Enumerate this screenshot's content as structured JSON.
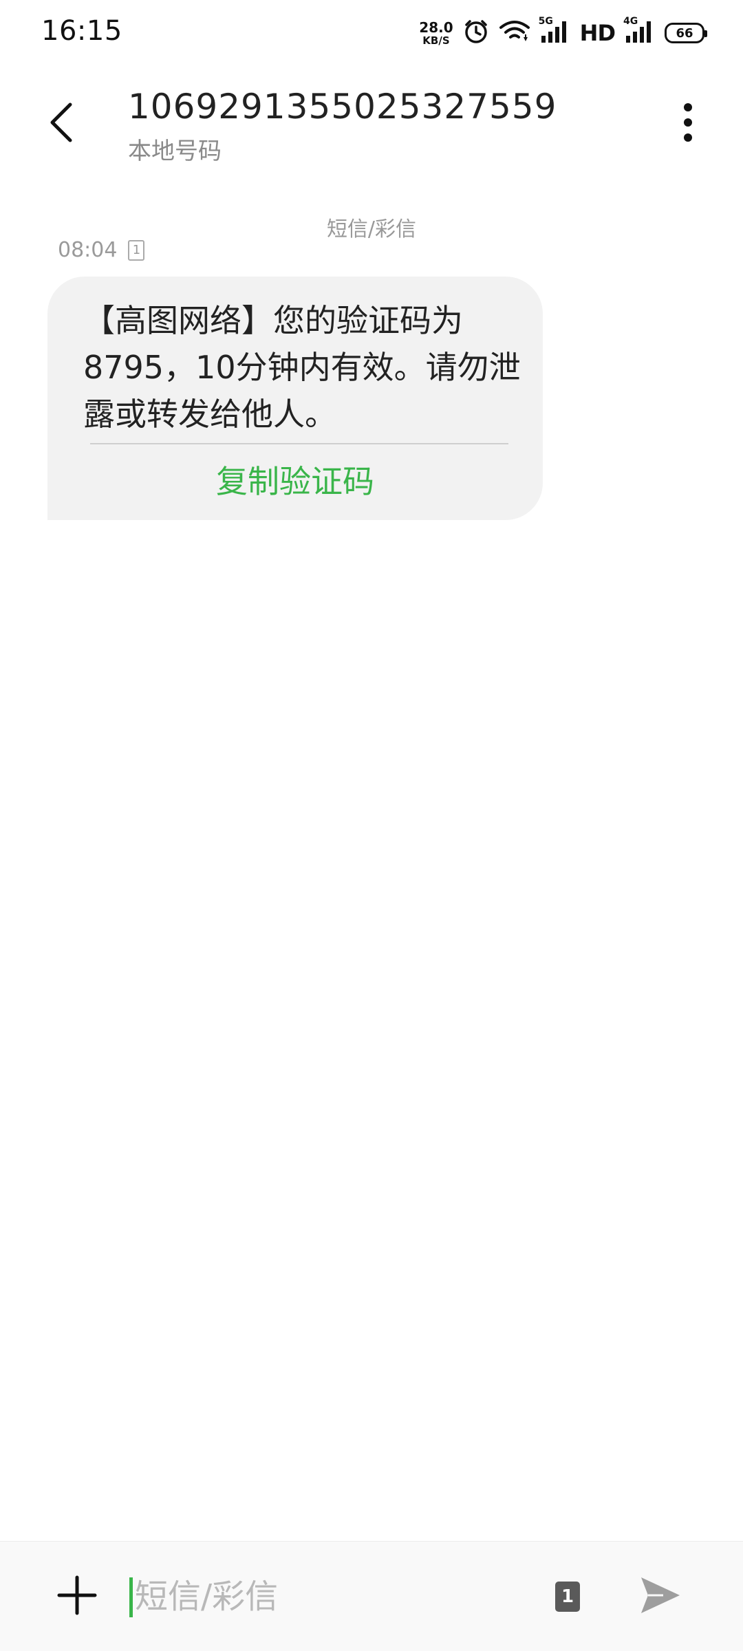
{
  "status_bar": {
    "time": "16:15",
    "net_speed_value": "28.0",
    "net_speed_unit": "KB/S",
    "sig1_label": "5G",
    "hd_label": "HD",
    "sig2_label": "4G",
    "battery_level": "66"
  },
  "header": {
    "contact_number": "1069291355025327559",
    "contact_subtitle": "本地号码"
  },
  "conversation": {
    "message_type_label": "短信/彩信",
    "messages": [
      {
        "time": "08:04",
        "sim_slot": "1",
        "text": "【高图网络】您的验证码为8795，10分钟内有效。请勿泄露或转发给他人。",
        "action_label": "复制验证码"
      }
    ]
  },
  "composer": {
    "placeholder": "短信/彩信",
    "sim_slot": "1"
  },
  "colors": {
    "accent_green": "#3ab54a",
    "bubble_bg": "#f2f2f2"
  }
}
